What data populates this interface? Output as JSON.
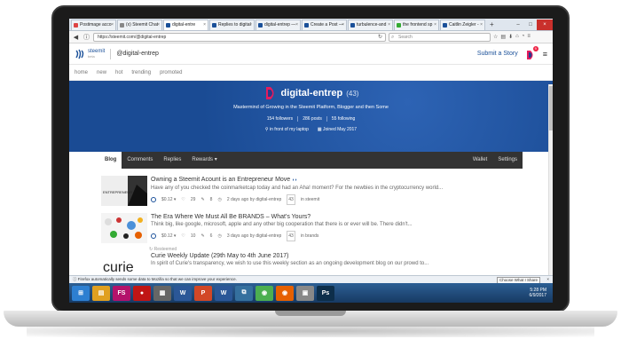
{
  "browser": {
    "tabs": [
      {
        "label": "Postimage acco",
        "color": "#d44"
      },
      {
        "label": "(x) Steemit Chat",
        "color": "#888"
      },
      {
        "label": "digital-entre",
        "color": "#1a5099",
        "active": true
      },
      {
        "label": "Replies to digital",
        "color": "#1a5099"
      },
      {
        "label": "digital-entrep —",
        "color": "#1a5099"
      },
      {
        "label": "Create a Post —",
        "color": "#1a5099"
      },
      {
        "label": "turbulence-and",
        "color": "#1a5099"
      },
      {
        "label": "the frontend sp",
        "color": "#3a3"
      },
      {
        "label": "Caitlin Zeigler -",
        "color": "#1a5099"
      }
    ],
    "url": "https://steemit.com/@digital-entrep",
    "search_placeholder": "Search"
  },
  "header": {
    "brand": "steemit",
    "brand_sub": "beta",
    "crumb": "@digital-entrep",
    "submit": "Submit a Story",
    "badge": "9"
  },
  "subnav": [
    "home",
    "new",
    "hot",
    "trending",
    "promoted"
  ],
  "profile": {
    "name": "digital-entrep",
    "rep": "(43)",
    "about": "Mastermind of Growing in the Steemit Platform, Blogger and then Some",
    "followers": "154 followers",
    "posts": "286 posts",
    "following": "55 following",
    "location": "in front of my laptop",
    "joined": "Joined May 2017"
  },
  "ptabs": {
    "blog": "Blog",
    "comments": "Comments",
    "replies": "Replies",
    "rewards": "Rewards ▾",
    "wallet": "Wallet",
    "settings": "Settings"
  },
  "posts": [
    {
      "title": "Owning a Steemit Acount is an Entrepreneur Move",
      "excerpt": "Have any of you checked the coinmarketcap today and had an Aha! moment? For the newbies in the cryptocurrency world...",
      "payout": "$0.12 ▾",
      "votes": "29",
      "comments": "8",
      "meta": "2 days ago by digital-entrep",
      "rep": "43",
      "tag": "in steemit"
    },
    {
      "title": "The Era Where We Must All Be BRANDS – What's Yours?",
      "excerpt": "Think big, like google, microsoft, apple and any other big cooperation that there is or ever will be. There didn't...",
      "payout": "$0.12 ▾",
      "votes": "10",
      "comments": "6",
      "meta": "3 days ago by digital-entrep",
      "rep": "43",
      "tag": "in brands"
    },
    {
      "resteemed": "Resteemed",
      "title": "Curie Weekly Update (29th May to 4th June 2017)",
      "excerpt": "In spirit of Curie's transparency, we wish to use this weekly section as an ongoing development blog on our prowd to..."
    }
  ],
  "thumb_text": {
    "post1": "ENTREPRENEUR",
    "post3": "curie"
  },
  "statusbar": {
    "message": "Firefox automatically sends some data to Mozilla so that we can improve your experience.",
    "button": "Choose What I Share"
  },
  "taskbar": {
    "icons": [
      {
        "name": "windows-start-icon",
        "color": "#2d7fd1",
        "glyph": "⊞"
      },
      {
        "name": "file-explorer-icon",
        "color": "#e0a020",
        "glyph": "▤"
      },
      {
        "name": "fs-app-icon",
        "color": "#b3126b",
        "glyph": "FS"
      },
      {
        "name": "media-icon",
        "color": "#c01515",
        "glyph": "●"
      },
      {
        "name": "printer-icon",
        "color": "#666",
        "glyph": "▦"
      },
      {
        "name": "word-icon",
        "color": "#2b5797",
        "glyph": "W"
      },
      {
        "name": "powerpoint-icon",
        "color": "#d24726",
        "glyph": "P"
      },
      {
        "name": "word2-icon",
        "color": "#2b5797",
        "glyph": "W"
      },
      {
        "name": "network-icon",
        "color": "#35709e",
        "glyph": "⧉"
      },
      {
        "name": "chrome-icon",
        "color": "#4caf50",
        "glyph": "◉"
      },
      {
        "name": "firefox-icon",
        "color": "#e66000",
        "glyph": "◉"
      },
      {
        "name": "app-icon",
        "color": "#888",
        "glyph": "▣"
      },
      {
        "name": "photoshop-icon",
        "color": "#0d2e4a",
        "glyph": "Ps"
      }
    ],
    "time": "5:28 PM",
    "date": "6/9/2017"
  }
}
